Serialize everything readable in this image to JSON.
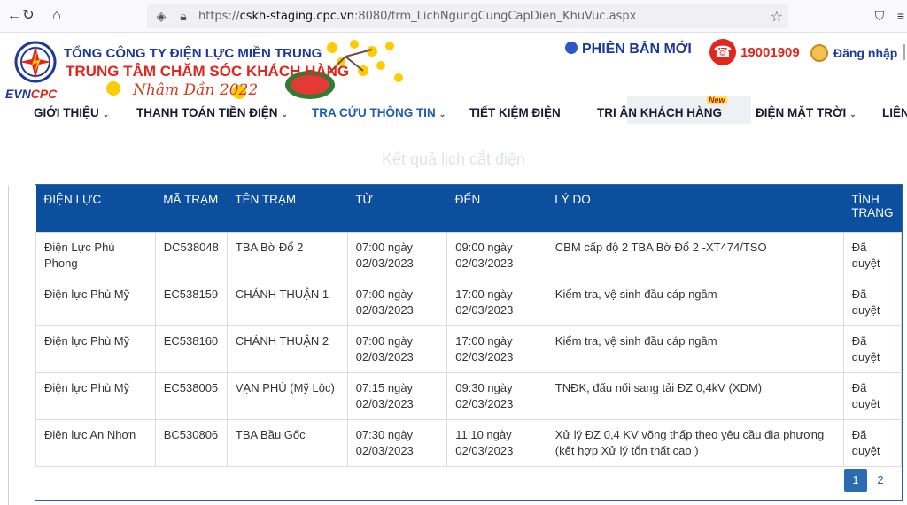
{
  "browser": {
    "url_host": "cskh-staging.cpc.vn",
    "url_prefix": "https://",
    "url_rest": ":8080/frm_LichNgungCungCapDien_KhuVuc.aspx"
  },
  "header": {
    "logo_evn": "EVN",
    "logo_cpc": "CPC",
    "org_line1": "TỔNG CÔNG TY ĐIỆN LỰC MIỀN TRUNG",
    "org_line2": "TRUNG TÂM CHĂM SÓC KHÁCH HÀNG",
    "tet_text": "Nhâm Dần 2022",
    "new_version": "PHIÊN BẢN MỚI",
    "hotline": "19001909",
    "login": "Đăng nhập"
  },
  "menu": {
    "items": [
      {
        "label": "GIỚI THIỆU",
        "caret": "⌄"
      },
      {
        "label": "THANH TOÁN TIỀN ĐIỆN",
        "caret": "⌄"
      },
      {
        "label": "TRA CỨU THÔNG TIN",
        "caret": "⌄"
      },
      {
        "label": "TIẾT KIỆM ĐIỆN",
        "caret": ""
      },
      {
        "label": "TRI ÂN KHÁCH HÀNG",
        "caret": ""
      },
      {
        "label": "ĐIỆN MẶT TRỜI",
        "caret": "⌄"
      },
      {
        "label": "LIÊN",
        "caret": ""
      }
    ],
    "new_badge": "New"
  },
  "result_title": "Kết quả lịch cắt điện",
  "table": {
    "headers": [
      "ĐIỆN LỰC",
      "MÃ TRẠM",
      "TÊN TRẠM",
      "TỪ",
      "ĐẾN",
      "LÝ DO",
      "TÌNH TRẠNG"
    ],
    "rows": [
      [
        "Điện Lực Phú Phong",
        "DC538048",
        "TBA Bờ Đổ 2",
        "07:00 ngày 02/03/2023",
        "09:00 ngày 02/03/2023",
        "CBM cấp độ 2 TBA Bờ Đổ 2 -XT474/TSO",
        "Đã duyệt"
      ],
      [
        "Điện lực Phù Mỹ",
        "EC538159",
        "CHÁNH THUẬN 1",
        "07:00 ngày 02/03/2023",
        "17:00 ngày 02/03/2023",
        "Kiểm tra, vệ sinh đầu cáp ngầm",
        "Đã duyệt"
      ],
      [
        "Điện lực Phù Mỹ",
        "EC538160",
        "CHÁNH THUẬN 2",
        "07:00 ngày 02/03/2023",
        "17:00 ngày 02/03/2023",
        "Kiểm tra, vệ sinh đầu cáp ngầm",
        "Đã duyệt"
      ],
      [
        "Điện lực Phù Mỹ",
        "EC538005",
        "VẠN PHÚ (Mỹ Lộc)",
        "07:15 ngày 02/03/2023",
        "09:30 ngày 02/03/2023",
        "TNĐK, đấu nối sang tải ĐZ 0,4kV (XDM)",
        "Đã duyệt"
      ],
      [
        "Điện lực An Nhơn",
        "BC530806",
        "TBA Bầu Gốc",
        "07:30 ngày 02/03/2023",
        "11:10 ngày 02/03/2023",
        "Xử lý ĐZ 0,4 KV võng thấp theo yêu cầu địa phương (kết hợp Xử lý tổn thất cao )",
        "Đã duyệt"
      ]
    ]
  },
  "pagination": {
    "pages": [
      "1",
      "2"
    ],
    "active": "1"
  }
}
